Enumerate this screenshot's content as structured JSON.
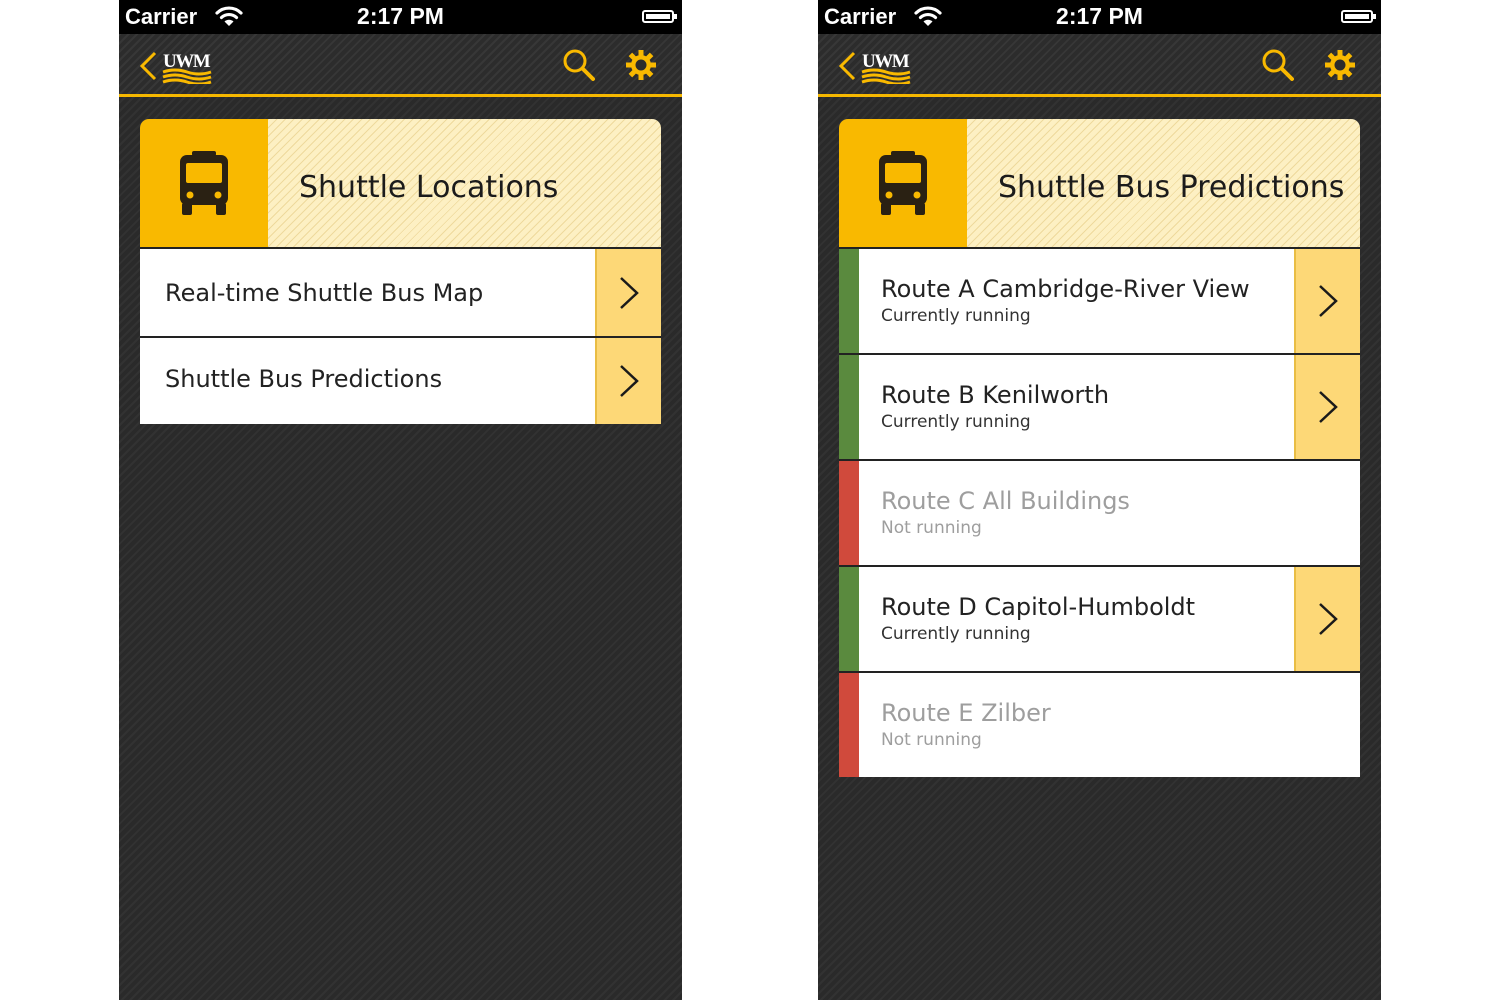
{
  "colors": {
    "accent": "#f9b900",
    "accent_light": "#fdd877",
    "header_bg": "#fdf0c3",
    "running": "#5a8a3e",
    "not_running": "#d04a3c",
    "app_bg": "#2a2a2a"
  },
  "left_screen": {
    "status_bar": {
      "carrier": "Carrier",
      "time": "2:17 PM",
      "icons": [
        "wifi-icon",
        "battery-icon"
      ]
    },
    "nav_bar": {
      "logo": "UWM",
      "icons": [
        "back-chevron-icon",
        "search-icon",
        "gear-icon"
      ]
    },
    "header": {
      "title": "Shuttle Locations",
      "icon": "bus-icon"
    },
    "menu_items": [
      {
        "label": "Real-time Shuttle Bus Map",
        "icon": "chevron-right-icon"
      },
      {
        "label": "Shuttle Bus Predictions",
        "icon": "chevron-right-icon"
      }
    ]
  },
  "right_screen": {
    "status_bar": {
      "carrier": "Carrier",
      "time": "2:17 PM",
      "icons": [
        "wifi-icon",
        "battery-icon"
      ]
    },
    "nav_bar": {
      "logo": "UWM",
      "icons": [
        "back-chevron-icon",
        "search-icon",
        "gear-icon"
      ]
    },
    "header": {
      "title": "Shuttle Bus Predictions",
      "icon": "bus-icon"
    },
    "routes": [
      {
        "name": "Route A Cambridge-River View",
        "status": "Currently running",
        "running": true
      },
      {
        "name": "Route B Kenilworth",
        "status": "Currently running",
        "running": true
      },
      {
        "name": "Route C All Buildings",
        "status": "Not running",
        "running": false
      },
      {
        "name": "Route D Capitol-Humboldt",
        "status": "Currently running",
        "running": true
      },
      {
        "name": "Route E Zilber",
        "status": "Not running",
        "running": false
      }
    ]
  }
}
